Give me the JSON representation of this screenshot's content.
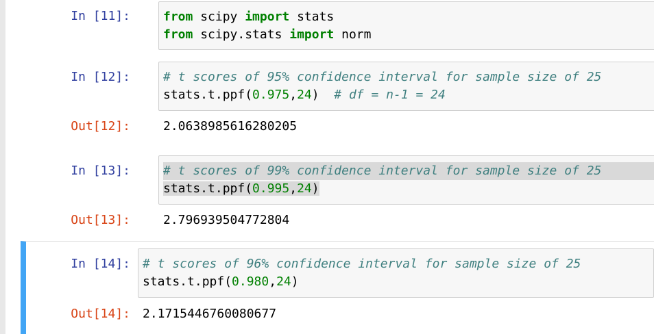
{
  "cells": [
    {
      "in_prompt": "In [11]:",
      "lines": [
        [
          "from",
          " scipy ",
          "import",
          " stats"
        ],
        [
          "from",
          " scipy.stats ",
          "import",
          " norm"
        ]
      ]
    },
    {
      "in_prompt": "In [12]:",
      "comment": "# t scores of 95% confidence interval for sample size of 25",
      "call_prefix": "stats.t.ppf(",
      "arg1": "0.975",
      "comma": ",",
      "arg2": "24",
      "call_close": ")",
      "trailing_comment": "  # df = n-1 = 24",
      "out_prompt": "Out[12]:",
      "output": "2.0638985616280205"
    },
    {
      "in_prompt": "In [13]:",
      "comment": "# t scores of 99% confidence interval for sample size of 25",
      "call_prefix": "stats.t.ppf(",
      "arg1": "0.995",
      "comma": ",",
      "arg2": "24",
      "call_close": ")",
      "out_prompt": "Out[13]:",
      "output": "2.796939504772804"
    },
    {
      "in_prompt": "In [14]:",
      "comment": "# t scores of 96% confidence interval for sample size of 25",
      "call_prefix": "stats.t.ppf(",
      "arg1": "0.980",
      "comma": ",",
      "arg2": "24",
      "call_close": ")",
      "out_prompt": "Out[14]:",
      "output": "2.1715446760080677"
    }
  ],
  "colors": {
    "in_prompt": "#303f9f",
    "out_prompt": "#d84315",
    "keyword": "#008000",
    "comment": "#408080",
    "selected_border": "#42a5f5"
  }
}
